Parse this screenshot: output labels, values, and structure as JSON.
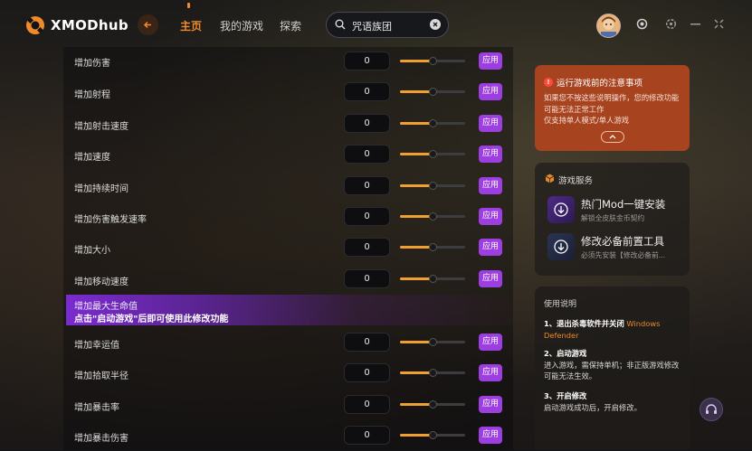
{
  "app": {
    "name": "XMODhub"
  },
  "nav": [
    {
      "label": "主页",
      "active": true
    },
    {
      "label": "我的游戏",
      "active": false
    },
    {
      "label": "探索",
      "active": false
    }
  ],
  "search": {
    "value": "咒语族团"
  },
  "mods": [
    {
      "label": "增加伤害",
      "value": "0",
      "button": "应用",
      "level": 0.5
    },
    {
      "label": "增加射程",
      "value": "0",
      "button": "应用",
      "level": 0.5
    },
    {
      "label": "增加射击速度",
      "value": "0",
      "button": "应用",
      "level": 0.5
    },
    {
      "label": "增加速度",
      "value": "0",
      "button": "应用",
      "level": 0.5
    },
    {
      "label": "增加持续时间",
      "value": "0",
      "button": "应用",
      "level": 0.5
    },
    {
      "label": "增加伤害触发速率",
      "value": "0",
      "button": "应用",
      "level": 0.5
    },
    {
      "label": "增加大小",
      "value": "0",
      "button": "应用",
      "level": 0.5
    },
    {
      "label": "增加移动速度",
      "value": "0",
      "button": "应用",
      "level": 0.5
    }
  ],
  "locked_mod": {
    "label": "增加最大生命值",
    "notice": "点击\"启动游戏\"后即可使用此修改功能"
  },
  "mods_after": [
    {
      "label": "增加幸运值",
      "value": "0",
      "button": "应用",
      "level": 0.5
    },
    {
      "label": "增加拾取半径",
      "value": "0",
      "button": "应用",
      "level": 0.5
    },
    {
      "label": "增加暴击率",
      "value": "0",
      "button": "应用",
      "level": 0.5
    },
    {
      "label": "增加暴击伤害",
      "value": "0",
      "button": "应用",
      "level": 0.5
    }
  ],
  "notice": {
    "title": "运行游戏前的注意事项",
    "body": "如果您不按这些说明操作，您的修改功能可能无法正常工作\n仅支持单人模式/单人游戏"
  },
  "services": {
    "title": "游戏服务",
    "items": [
      {
        "name": "热门Mod一键安装",
        "sub": "解锁全皮肤金币契约"
      },
      {
        "name": "修改必备前置工具",
        "sub": "必须先安装【修改必备前..."
      }
    ]
  },
  "usage": {
    "title": "使用说明",
    "step1_title": "1、退出杀毒软件并关闭",
    "step1_highlight": "Windows Defender",
    "step2_title": "2、启动游戏",
    "step2_body": "进入游戏，需保持单机；非正版游戏修改可能无法生效。",
    "step3_title": "3、开启修改",
    "step3_body": "启动游戏成功后，开启修改。"
  },
  "colors": {
    "accent": "#f08a2c",
    "apply": "#9c3ee0",
    "notice_bg": "#a8431f"
  }
}
